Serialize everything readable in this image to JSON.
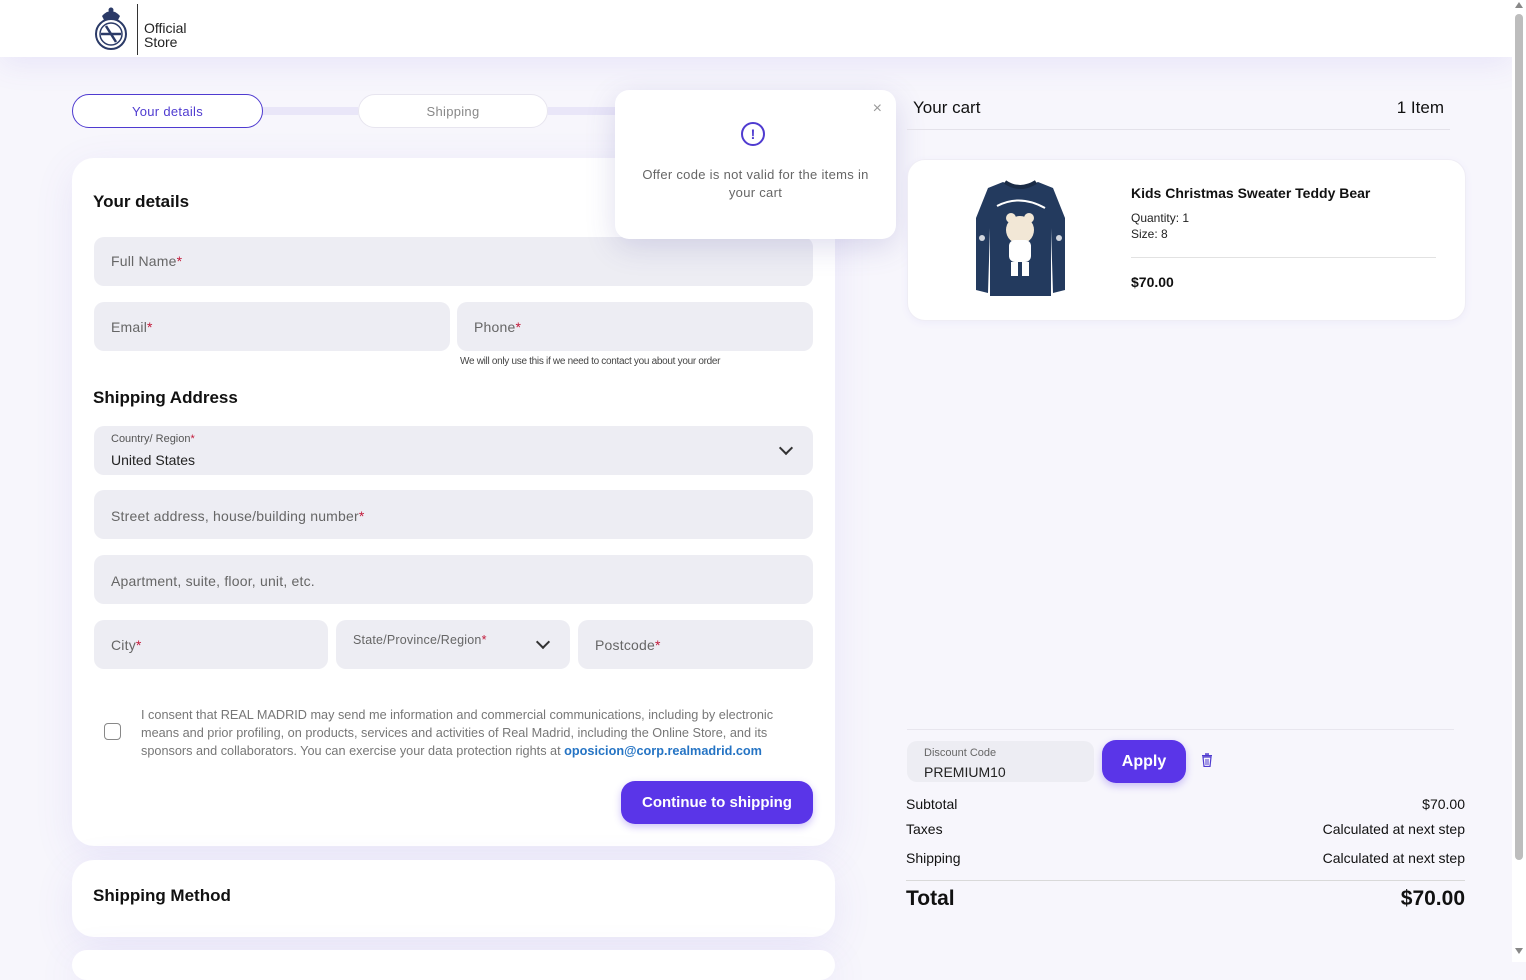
{
  "header": {
    "logo_line1": "Official",
    "logo_line2": "Store"
  },
  "steps": [
    {
      "label": "Your details",
      "active": true
    },
    {
      "label": "Shipping",
      "active": false
    }
  ],
  "details": {
    "title": "Your details",
    "full_name": "Full Name",
    "email": "Email",
    "phone": "Phone",
    "phone_hint": "We will only use this if we need to contact you about your order",
    "required_mark": "*"
  },
  "address": {
    "title": "Shipping Address",
    "country_label": "Country/ Region",
    "country_value": "United States",
    "street": "Street address, house/building number",
    "apartment": "Apartment, suite, floor, unit, etc.",
    "city": "City",
    "state": "State/Province/Region",
    "postcode": "Postcode"
  },
  "consent": {
    "text": "I consent that REAL MADRID may send me information and commercial communications, including by electronic means and prior profiling, on products, services and activities of Real Madrid, including the Online Store, and its sponsors and collaborators. You can exercise your data protection rights at ",
    "email": "oposicion@corp.realmadrid.com",
    "checked": false
  },
  "continue_label": "Continue to shipping",
  "shipping_method_title": "Shipping Method",
  "popup": {
    "message": "Offer code is not valid for the items in your cart",
    "close_glyph": "×",
    "icon_glyph": "!"
  },
  "cart": {
    "title": "Your cart",
    "count": "1 Item",
    "item": {
      "name": "Kids Christmas Sweater Teddy Bear",
      "quantity": "Quantity: 1",
      "size": "Size: 8",
      "price": "$70.00"
    },
    "discount_label": "Discount Code",
    "discount_value": "PREMIUM10",
    "apply_label": "Apply",
    "subtotal_label": "Subtotal",
    "subtotal_value": "$70.00",
    "taxes_label": "Taxes",
    "taxes_value": "Calculated at next step",
    "shipping_label": "Shipping",
    "shipping_value": "Calculated at next step",
    "total_label": "Total",
    "total_value": "$70.00"
  },
  "colors": {
    "accent": "#5a35e8",
    "step_active": "#4f3bd0",
    "required": "#c21a3a",
    "link": "#2574c4"
  },
  "icons": [
    "crest-logo-icon",
    "chevron-down-icon",
    "alert-circle-icon",
    "close-icon",
    "trash-icon"
  ]
}
